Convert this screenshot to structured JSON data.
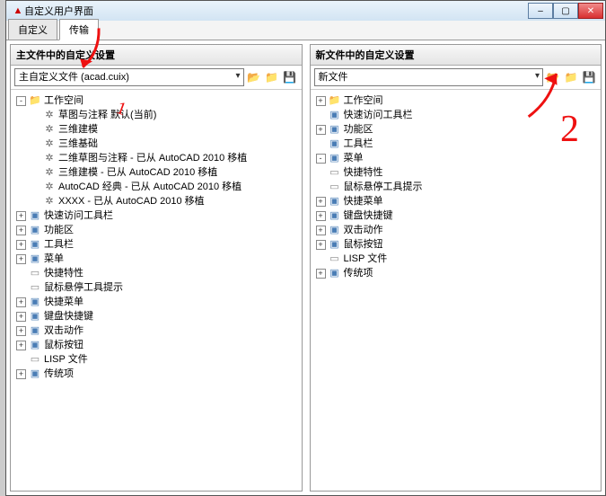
{
  "window": {
    "title": "自定义用户界面"
  },
  "win_buttons": {
    "min": "–",
    "max": "▢",
    "close": "✕"
  },
  "tabs": [
    {
      "label": "自定义",
      "active": false
    },
    {
      "label": "传输",
      "active": true
    }
  ],
  "left": {
    "header": "主文件中的自定义设置",
    "dropdown": "主自定义文件 (acad.cuix)",
    "toolbar": {
      "open": "folder-open-icon",
      "browse": "folder-icon",
      "save": "save-icon"
    },
    "tree": [
      {
        "exp": "-",
        "icon": "folder",
        "label": "工作空间",
        "children": [
          {
            "exp": " ",
            "icon": "gear",
            "label": "草图与注释 默认(当前)"
          },
          {
            "exp": " ",
            "icon": "gear",
            "label": "三维建模"
          },
          {
            "exp": " ",
            "icon": "gear",
            "label": "三维基础"
          },
          {
            "exp": " ",
            "icon": "gear",
            "label": "二维草图与注释 - 已从 AutoCAD 2010 移植"
          },
          {
            "exp": " ",
            "icon": "gear",
            "label": "三维建模 - 已从 AutoCAD 2010 移植"
          },
          {
            "exp": " ",
            "icon": "gear",
            "label": "AutoCAD 经典 - 已从 AutoCAD 2010 移植"
          },
          {
            "exp": " ",
            "icon": "gear",
            "label": "XXXX - 已从 AutoCAD 2010 移植"
          }
        ]
      },
      {
        "exp": "+",
        "icon": "item",
        "label": "快速访问工具栏"
      },
      {
        "exp": "+",
        "icon": "item",
        "label": "功能区"
      },
      {
        "exp": "+",
        "icon": "item",
        "label": "工具栏"
      },
      {
        "exp": "+",
        "icon": "item",
        "label": "菜单"
      },
      {
        "exp": " ",
        "icon": "sheet",
        "label": "快捷特性"
      },
      {
        "exp": " ",
        "icon": "sheet",
        "label": "鼠标悬停工具提示"
      },
      {
        "exp": "+",
        "icon": "item",
        "label": "快捷菜单"
      },
      {
        "exp": "+",
        "icon": "item",
        "label": "键盘快捷键"
      },
      {
        "exp": "+",
        "icon": "item",
        "label": "双击动作"
      },
      {
        "exp": "+",
        "icon": "item",
        "label": "鼠标按钮"
      },
      {
        "exp": " ",
        "icon": "sheet",
        "label": "LISP 文件"
      },
      {
        "exp": "+",
        "icon": "item",
        "label": "传统项"
      }
    ]
  },
  "right": {
    "header": "新文件中的自定义设置",
    "dropdown": "新文件",
    "toolbar": {
      "open": "folder-open-icon",
      "browse": "folder-icon",
      "save": "save-icon"
    },
    "tree": [
      {
        "exp": "+",
        "icon": "folder",
        "label": "工作空间"
      },
      {
        "exp": " ",
        "icon": "item",
        "label": "快速访问工具栏"
      },
      {
        "exp": "+",
        "icon": "item",
        "label": "功能区"
      },
      {
        "exp": " ",
        "icon": "item",
        "label": "工具栏"
      },
      {
        "exp": "-",
        "icon": "item",
        "label": "菜单"
      },
      {
        "exp": " ",
        "icon": "sheet",
        "label": "快捷特性"
      },
      {
        "exp": " ",
        "icon": "sheet",
        "label": "鼠标悬停工具提示"
      },
      {
        "exp": "+",
        "icon": "item",
        "label": "快捷菜单"
      },
      {
        "exp": "+",
        "icon": "item",
        "label": "键盘快捷键"
      },
      {
        "exp": "+",
        "icon": "item",
        "label": "双击动作"
      },
      {
        "exp": "+",
        "icon": "item",
        "label": "鼠标按钮"
      },
      {
        "exp": " ",
        "icon": "sheet",
        "label": "LISP 文件"
      },
      {
        "exp": "+",
        "icon": "item",
        "label": "传统项"
      }
    ]
  },
  "annotations": {
    "one": "1",
    "two": "2"
  }
}
